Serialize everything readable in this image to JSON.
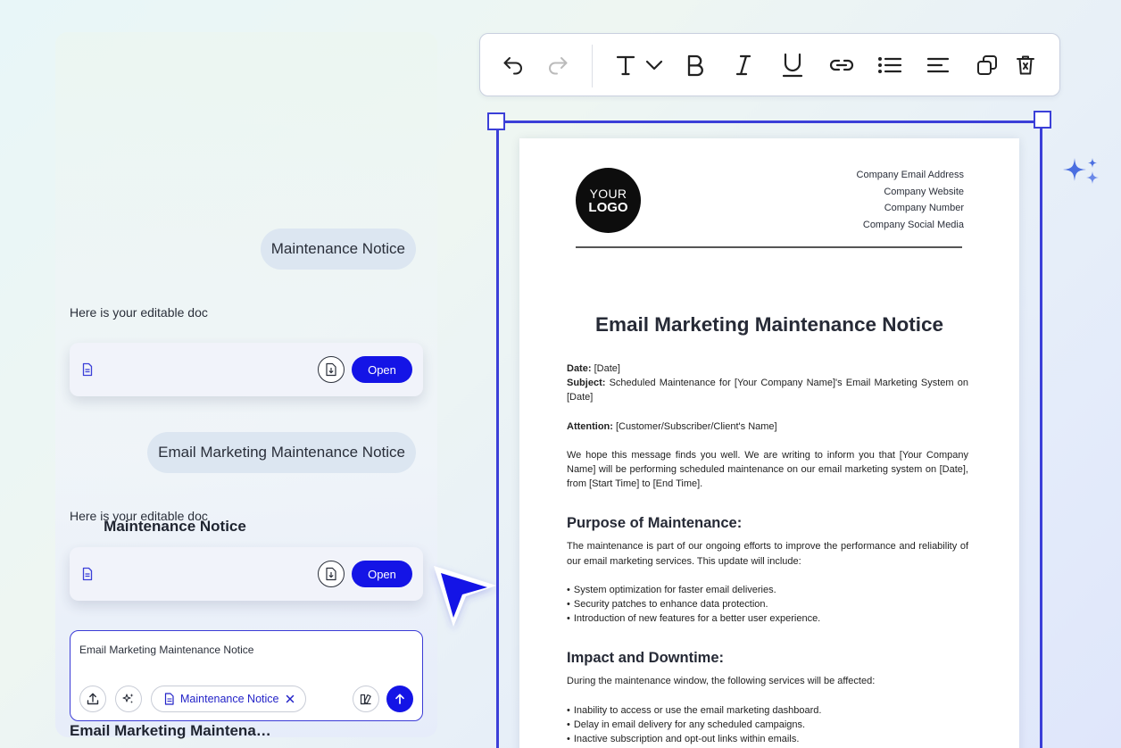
{
  "chat": {
    "messages": [
      {
        "user_text": "Maintenance Notice",
        "bot_text": "Here is your editable doc",
        "doc_title": "Maintenance Notice",
        "open_label": "Open"
      },
      {
        "user_text": "Email Marketing Maintenance Notice",
        "bot_text": "Here is your editable doc",
        "doc_title": "Email Marketing Maintenance Notice",
        "open_label": "Open"
      }
    ],
    "input": {
      "value": "Email Marketing Maintenance Notice",
      "chip_label": "Maintenance Notice"
    }
  },
  "toolbar": {
    "icons": [
      "undo-icon",
      "redo-icon",
      "text-style-icon",
      "chevron-down-icon",
      "bold-icon",
      "italic-icon",
      "underline-icon",
      "link-icon",
      "bulleted-list-icon",
      "align-left-icon",
      "duplicate-icon",
      "delete-icon"
    ]
  },
  "document": {
    "logo": {
      "line1": "YOUR",
      "line2": "LOGO"
    },
    "company_info": [
      "Company Email Address",
      "Company Website",
      "Company Number",
      "Company Social Media"
    ],
    "title": "Email Marketing Maintenance Notice",
    "date_label": "Date:",
    "date_value": " [Date]",
    "subject_label": "Subject:",
    "subject_value": " Scheduled Maintenance for [Your Company Name]'s Email Marketing System on [Date]",
    "attention_label": "Attention:",
    "attention_value": " [Customer/Subscriber/Client's Name]",
    "intro": "We hope this message finds you well. We are writing to inform you that [Your Company Name] will be performing scheduled maintenance on our email marketing system on [Date], from [Start Time] to [End Time].",
    "section1_heading": "Purpose of Maintenance:",
    "section1_text": "The maintenance is part of our ongoing efforts to improve the performance and reliability of our email marketing services. This update will include:",
    "section1_items": [
      "System optimization for faster email deliveries.",
      "Security patches to enhance data protection.",
      "Introduction of new features for a better user experience."
    ],
    "section2_heading": "Impact and Downtime:",
    "section2_text": "During the maintenance window, the following services will be affected:",
    "section2_items": [
      "Inability to access or use the email marketing dashboard.",
      "Delay in email delivery for any scheduled campaigns.",
      "Inactive subscription and opt-out links within emails."
    ]
  },
  "colors": {
    "accent": "#1414e6",
    "frame": "#3b3fd8",
    "sparkle": "#4a6ee0"
  }
}
